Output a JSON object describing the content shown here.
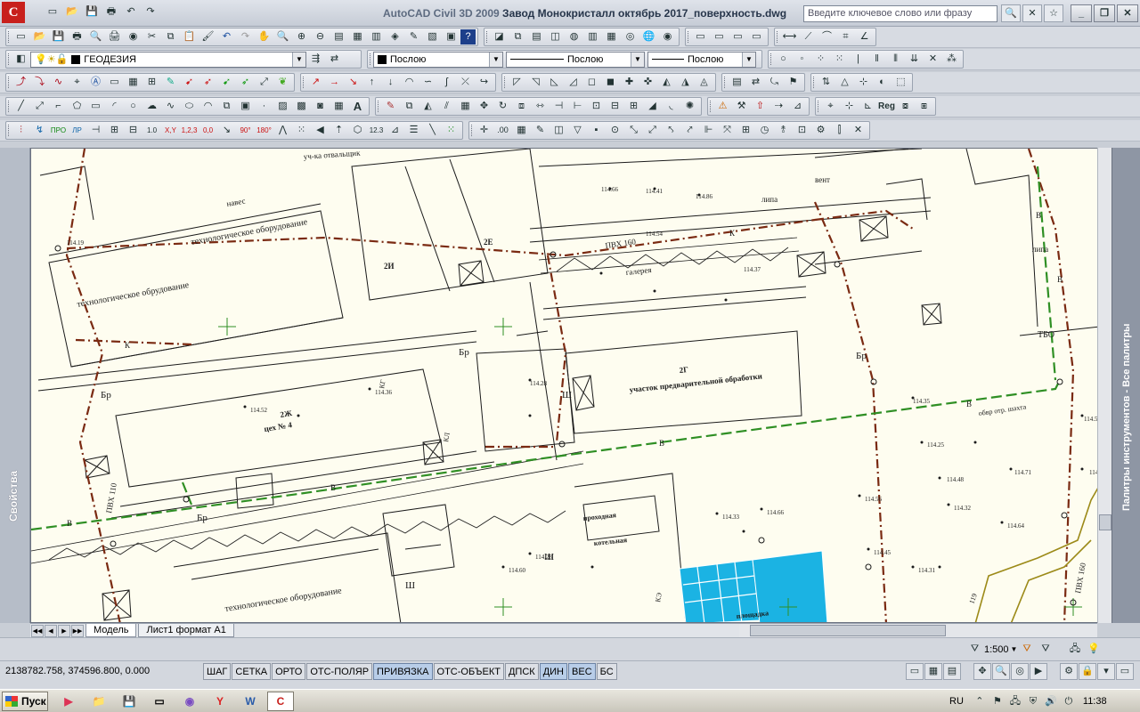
{
  "window": {
    "app_name": "AutoCAD Civil 3D 2009",
    "file_title": "Завод Монокристалл октябрь 2017_поверхность.dwg",
    "search_placeholder": "Введите ключевое слово или фразу",
    "logo_letter": "C"
  },
  "layers": {
    "current_layer": "ГЕОДЕЗИЯ",
    "color": "Послою",
    "linetype": "Послою",
    "lineweight": "Послою"
  },
  "drawing": {
    "background": "#fefdf0",
    "labels": {
      "tech1": "технологическое оборудование",
      "tech2": "технологическое обрудование",
      "tech3": "технологическое оборудование",
      "ceh4_code": "2Ж",
      "ceh4": "цех № 4",
      "area_code": "2Г",
      "area": "участок предварительной обработки",
      "pvh160_top": "ПВХ 160",
      "pvh160_right": "ПВХ 160",
      "pvh110": "ПВХ 110",
      "br1": "Бр",
      "br2": "Бр",
      "br3": "Бр",
      "br4": "Бр",
      "tbo": "ТБО",
      "k1": "К",
      "k2": "К",
      "b1": "В",
      "b2": "В",
      "b3": "В",
      "b4": "В",
      "b5": "В",
      "b6": "В",
      "sh1": "Ш",
      "sh2": "Ш",
      "sh3": "Ш",
      "vent": "вент",
      "lipa1": "липа",
      "lipa2": "липа",
      "galereya": "галерея",
      "navesy": "навес",
      "plates": "119",
      "ploshad": "площадка",
      "kotelnaya": "котельная",
      "prohodnaya": "проходная",
      "luchka": "уч-ка отвальщик",
      "sewer": "обвр отр. шахта",
      "kg": "КГ",
      "kl": "КЛ",
      "ke": "КЭ",
      "n2e": "2Е",
      "n2": "2И",
      "spot1": "114.66",
      "spot2": "114.54",
      "spot3": "114.86",
      "spot4": "114.41",
      "spot5": "114.37",
      "spot6": "114.28",
      "spot7": "114.35",
      "spot8": "114.25",
      "spot9": "114.48",
      "spot10": "114.56",
      "spot11": "114.45",
      "spot12": "114.32",
      "spot13": "114.64",
      "spot14": "114.71",
      "spot15": "114.50",
      "spot16": "114.60",
      "spot17": "114.28",
      "spot18": "114.33",
      "spot19": "114.66",
      "spot20": "114.52",
      "spot21": "114.36",
      "spot22": "114.19",
      "spot23": "114.31",
      "spot24": "114.42"
    }
  },
  "palettes": {
    "left": "Свойства",
    "right": "Палитры инструментов - Все палитры"
  },
  "layout_tabs": [
    "Модель",
    "Лист1 формат А1"
  ],
  "annotation_scale": "1:500",
  "status": {
    "coords": "2138782.758, 374596.800, 0.000",
    "toggles": [
      {
        "label": "ШАГ",
        "on": false
      },
      {
        "label": "СЕТКА",
        "on": false
      },
      {
        "label": "ОРТО",
        "on": false
      },
      {
        "label": "ОТС-ПОЛЯР",
        "on": false
      },
      {
        "label": "ПРИВЯЗКА",
        "on": true
      },
      {
        "label": "ОТС-ОБЪЕКТ",
        "on": false
      },
      {
        "label": "ДПСК",
        "on": false
      },
      {
        "label": "ДИН",
        "on": true
      },
      {
        "label": "ВЕС",
        "on": true
      },
      {
        "label": "БС",
        "on": false
      }
    ]
  },
  "taskbar": {
    "start": "Пуск",
    "lang": "RU",
    "clock": "11:38"
  },
  "colors": {
    "accent": "#c8201c",
    "water_line": "#2f8f24",
    "sewer_line": "#7a2a12",
    "pool": "#1bb3e3"
  }
}
